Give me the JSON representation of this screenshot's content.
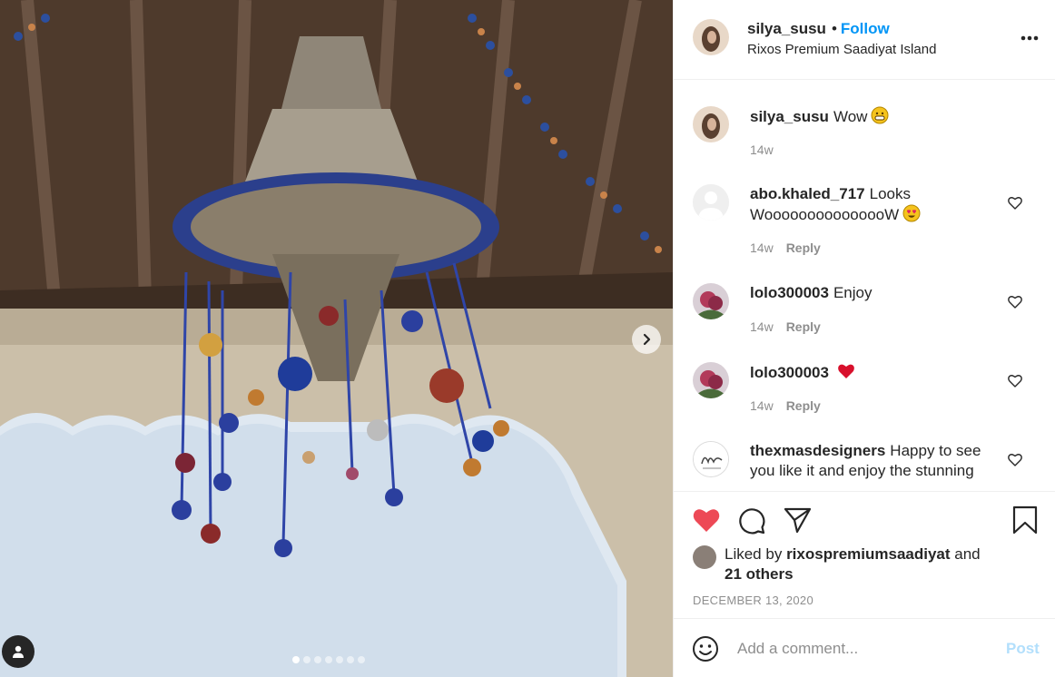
{
  "post": {
    "author": "silya_susu",
    "follow_separator": "•",
    "follow_label": "Follow",
    "location": "Rixos Premium Saadiyat Island",
    "photo_count": 7,
    "active_photo": 1
  },
  "comments": [
    {
      "user": "silya_susu",
      "text": "Wow",
      "emoji": "grinning-face",
      "time": "14w",
      "reply": ""
    },
    {
      "user": "abo.khaled_717",
      "text": "Looks WooooooooooooooW",
      "emoji": "heart-eyes-face",
      "time": "14w",
      "reply": "Reply"
    },
    {
      "user": "lolo300003",
      "text": "Enjoy",
      "emoji": "",
      "time": "14w",
      "reply": "Reply"
    },
    {
      "user": "lolo300003",
      "text": "",
      "emoji": "red-heart",
      "time": "14w",
      "reply": "Reply"
    },
    {
      "user": "thexmasdesigners",
      "text": "Happy to see you like it and enjoy the stunning",
      "emoji": "",
      "time": "",
      "reply": ""
    }
  ],
  "likes": {
    "prefix": "Liked by",
    "liker": "rixospremiumsaadiyat",
    "suffix_and": "and",
    "others": "21 others"
  },
  "date": "DECEMBER 13, 2020",
  "add_comment": {
    "placeholder": "Add a comment...",
    "post_label": "Post"
  },
  "colors": {
    "link_blue": "#0095f6",
    "like_red": "#ed4956",
    "post_disabled": "#b2dffc",
    "secondary_text": "#8e8e8e"
  }
}
